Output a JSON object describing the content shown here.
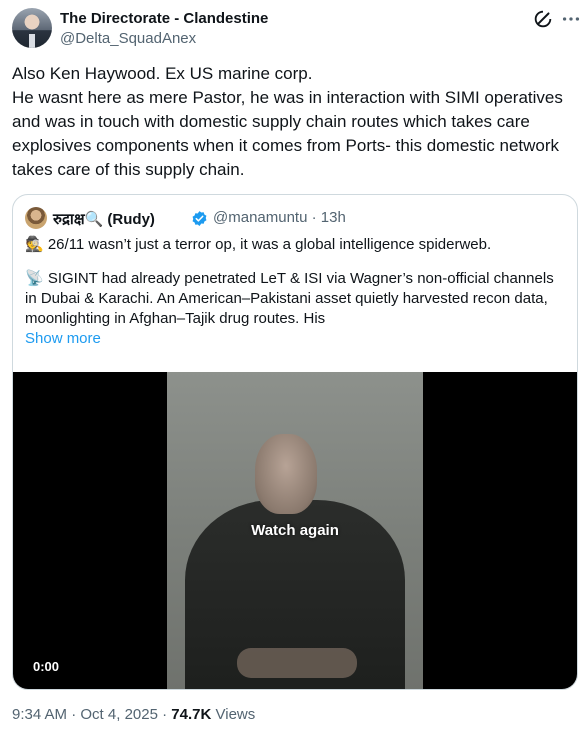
{
  "author": {
    "name": "The Directorate - Clandestine",
    "handle": "@Delta_SquadAnex",
    "avatar_icon": "avatar-photo"
  },
  "header_icons": {
    "grok": "grok-icon",
    "more": "more-icon"
  },
  "post": {
    "lines": [
      "Also Ken Haywood. Ex US marine corp.",
      "He wasnt here as mere Pastor, he was in interaction with SIMI operatives and was in touch with domestic supply chain routes which takes care explosives components when it comes from Ports- this domestic network takes care of this supply chain."
    ]
  },
  "quote": {
    "name": "रुद्राक्ष🔍 (Rudy)",
    "verified_icon": "verified-badge-icon",
    "handle": "@manamuntu",
    "separator": "·",
    "time": "13h",
    "para1": "🕵️ 26/11 wasn’t just a terror op, it was a global intelligence spiderweb.",
    "para2": "📡 SIGINT had already penetrated LeT & ISI via Wagner’s non-official channels in Dubai & Karachi. An American–Pakistani asset quietly harvested recon data, moonlighting in Afghan–Tajik drug routes. His",
    "show_more": "Show more",
    "video": {
      "overlay_label": "Watch again",
      "timestamp": "0:00"
    }
  },
  "meta": {
    "time": "9:34 AM",
    "dot": "·",
    "date": "Oct 4, 2025",
    "views_count": "74.7K",
    "views_label": "Views"
  },
  "colors": {
    "text": "#0f1419",
    "secondary": "#536471",
    "link": "#1d9bf0",
    "border": "#cfd9de",
    "verified": "#1d9bf0"
  }
}
